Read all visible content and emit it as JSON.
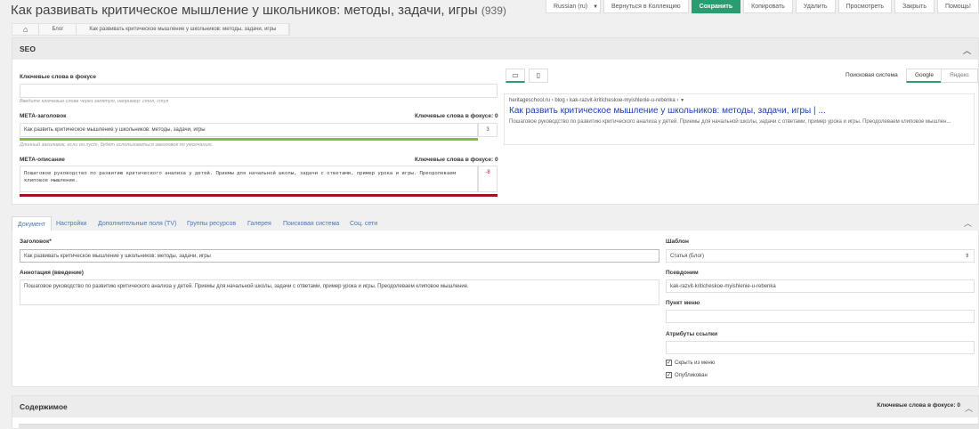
{
  "header": {
    "title": "Как развивать критическое мышление у школьников: методы, задачи, игры",
    "count": "(939)"
  },
  "actions": {
    "language": "Russian (ru)",
    "back": "Вернуться в Коллекцию",
    "save": "Сохранить",
    "copy": "Копировать",
    "delete": "Удалить",
    "view": "Просмотреть",
    "close": "Закрыть",
    "help": "Помощь!"
  },
  "breadcrumb": {
    "blog": "Блог",
    "current": "Как развивать критическое мышление у школьников: методы, задачи, игры"
  },
  "seo": {
    "title": "SEO",
    "focus_keywords_label": "Ключевые слова в фокусе",
    "focus_keywords_value": "",
    "focus_keywords_hint": "Введите ключевые слова через запятую, например: стол, стул",
    "meta_title_label": "META-заголовок",
    "meta_title_kw": "Ключевые слова в фокусе: 0",
    "meta_title_value": "Как развить критическое мышление у школьников: методы, задачи, игры",
    "meta_title_counter": "3",
    "meta_title_hint": "Длинный заголовок, если он пуст, будет использоваться заголовок по умолчанию.",
    "meta_desc_label": "META-описание",
    "meta_desc_kw": "Ключевые слова в фокусе: 0",
    "meta_desc_value": "Пошаговое руководство по развитию критического анализа у детей. Приемы для начальной школы, задачи с ответами, пример урока и игры. Преодолеваем клиповое мышление.",
    "meta_desc_counter": "-8",
    "search_engine_label": "Поисковая система",
    "engine_google": "Google",
    "engine_yandex": "Яндекс",
    "preview": {
      "url": "heritageschool.ru › blog › kak-razvit-kriticheskoe-myishlenie-u-rebenka ›",
      "title": "Как развить критическое мышление у школьников: методы, задачи, игры | ...",
      "desc": "Пошаговое руководство по развитию критического анализа у детей. Приемы для начальной школы, задачи с ответами, пример урока и игры. Преодолеваем клиповое мышлен..."
    },
    "colors": {
      "good": "#79c142",
      "bad": "#9e1320"
    }
  },
  "tabs": [
    "Документ",
    "Настройки",
    "Дополнительные поля (TV)",
    "Группы ресурсов",
    "Галерея",
    "Поисковая система",
    "Соц. сети"
  ],
  "document": {
    "heading_label": "Заголовок*",
    "heading_value": "Как развивать критическое мышление у школьников: методы, задачи, игры",
    "intro_label": "Аннотация (введение)",
    "intro_value": "Пошаговое руководство по развитию критического анализа у детей. Приемы для начальной школы, задачи с ответами, пример урока и игры. Преодолеваем клиповое мышление.",
    "template_label": "Шаблон",
    "template_value": "Статья (Блог)",
    "alias_label": "Псевдоним",
    "alias_value": "kak-razvit-kriticheskoe-myishlenie-u-rebenka",
    "menu_label": "Пункт меню",
    "menu_value": "",
    "link_attr_label": "Атрибуты ссылки",
    "link_attr_value": "",
    "hide_menu": "Скрыть из меню",
    "published": "Опубликован"
  },
  "content": {
    "title": "Содержимое",
    "kw": "Ключевые слова в фокусе: 0"
  }
}
